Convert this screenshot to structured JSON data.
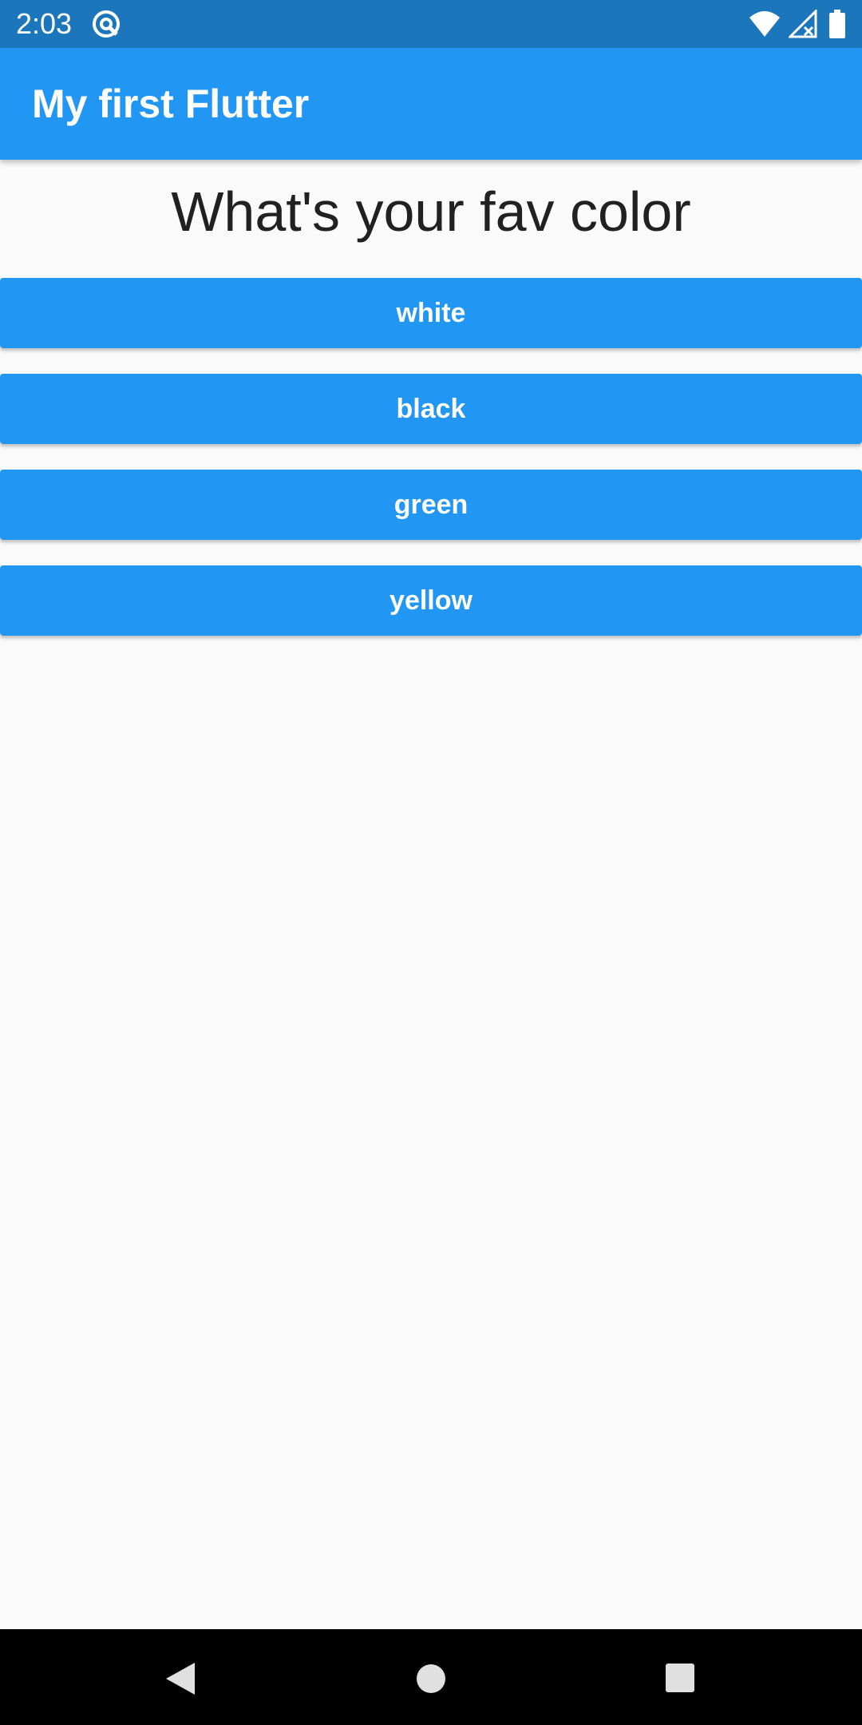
{
  "status_bar": {
    "time": "2:03",
    "background": "#1b76bc",
    "icons": [
      "app-notification-icon",
      "wifi-icon",
      "signal-icon",
      "battery-icon"
    ]
  },
  "app_bar": {
    "title": "My first Flutter",
    "background": "#2196f3"
  },
  "main": {
    "question": "What's your fav color",
    "answers": [
      {
        "label": "white"
      },
      {
        "label": "black"
      },
      {
        "label": "green"
      },
      {
        "label": "yellow"
      }
    ],
    "button_color": "#2196f3"
  },
  "nav_bar": {
    "icons": [
      "back-icon",
      "home-icon",
      "recents-icon"
    ]
  }
}
